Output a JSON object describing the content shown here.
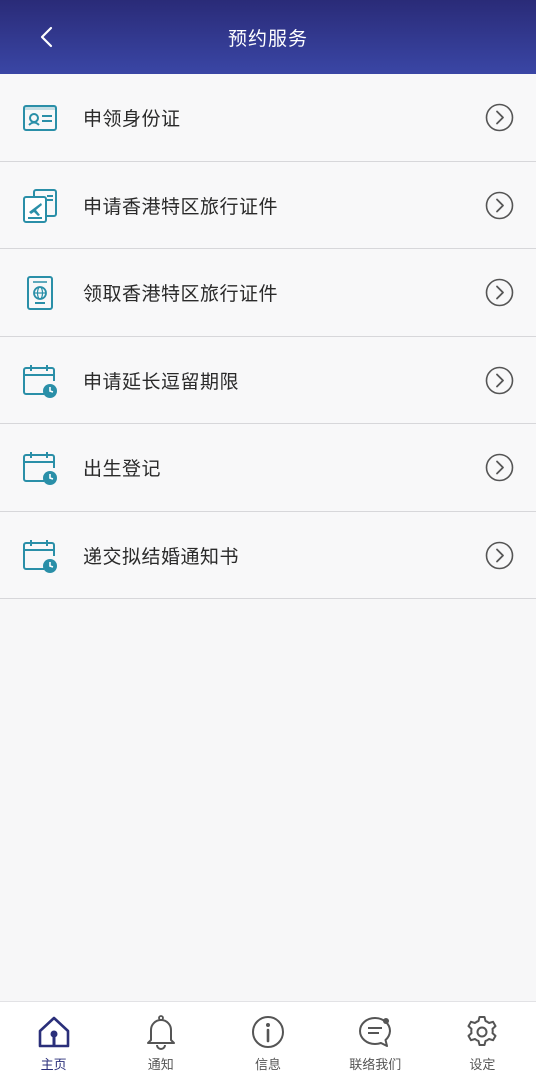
{
  "header": {
    "title": "预约服务",
    "back_icon": "chevron-left-icon"
  },
  "services": [
    {
      "label": "申领身份证",
      "icon": "id-card-icon"
    },
    {
      "label": "申请香港特区旅行证件",
      "icon": "travel-document-icon"
    },
    {
      "label": "领取香港特区旅行证件",
      "icon": "passport-icon"
    },
    {
      "label": "申请延长逗留期限",
      "icon": "calendar-clock-icon"
    },
    {
      "label": "出生登记",
      "icon": "calendar-clock-icon"
    },
    {
      "label": "递交拟结婚通知书",
      "icon": "calendar-clock-icon"
    }
  ],
  "tabs": [
    {
      "label": "主页",
      "icon": "home-icon",
      "active": true
    },
    {
      "label": "通知",
      "icon": "bell-icon",
      "active": false
    },
    {
      "label": "信息",
      "icon": "info-icon",
      "active": false
    },
    {
      "label": "联络我们",
      "icon": "chat-icon",
      "active": false
    },
    {
      "label": "设定",
      "icon": "gear-icon",
      "active": false
    }
  ],
  "colors": {
    "header_gradient_top": "#2a2b78",
    "header_gradient_bottom": "#3a46a5",
    "icon_teal": "#2a8fa8",
    "tab_active": "#2a2f7a"
  }
}
